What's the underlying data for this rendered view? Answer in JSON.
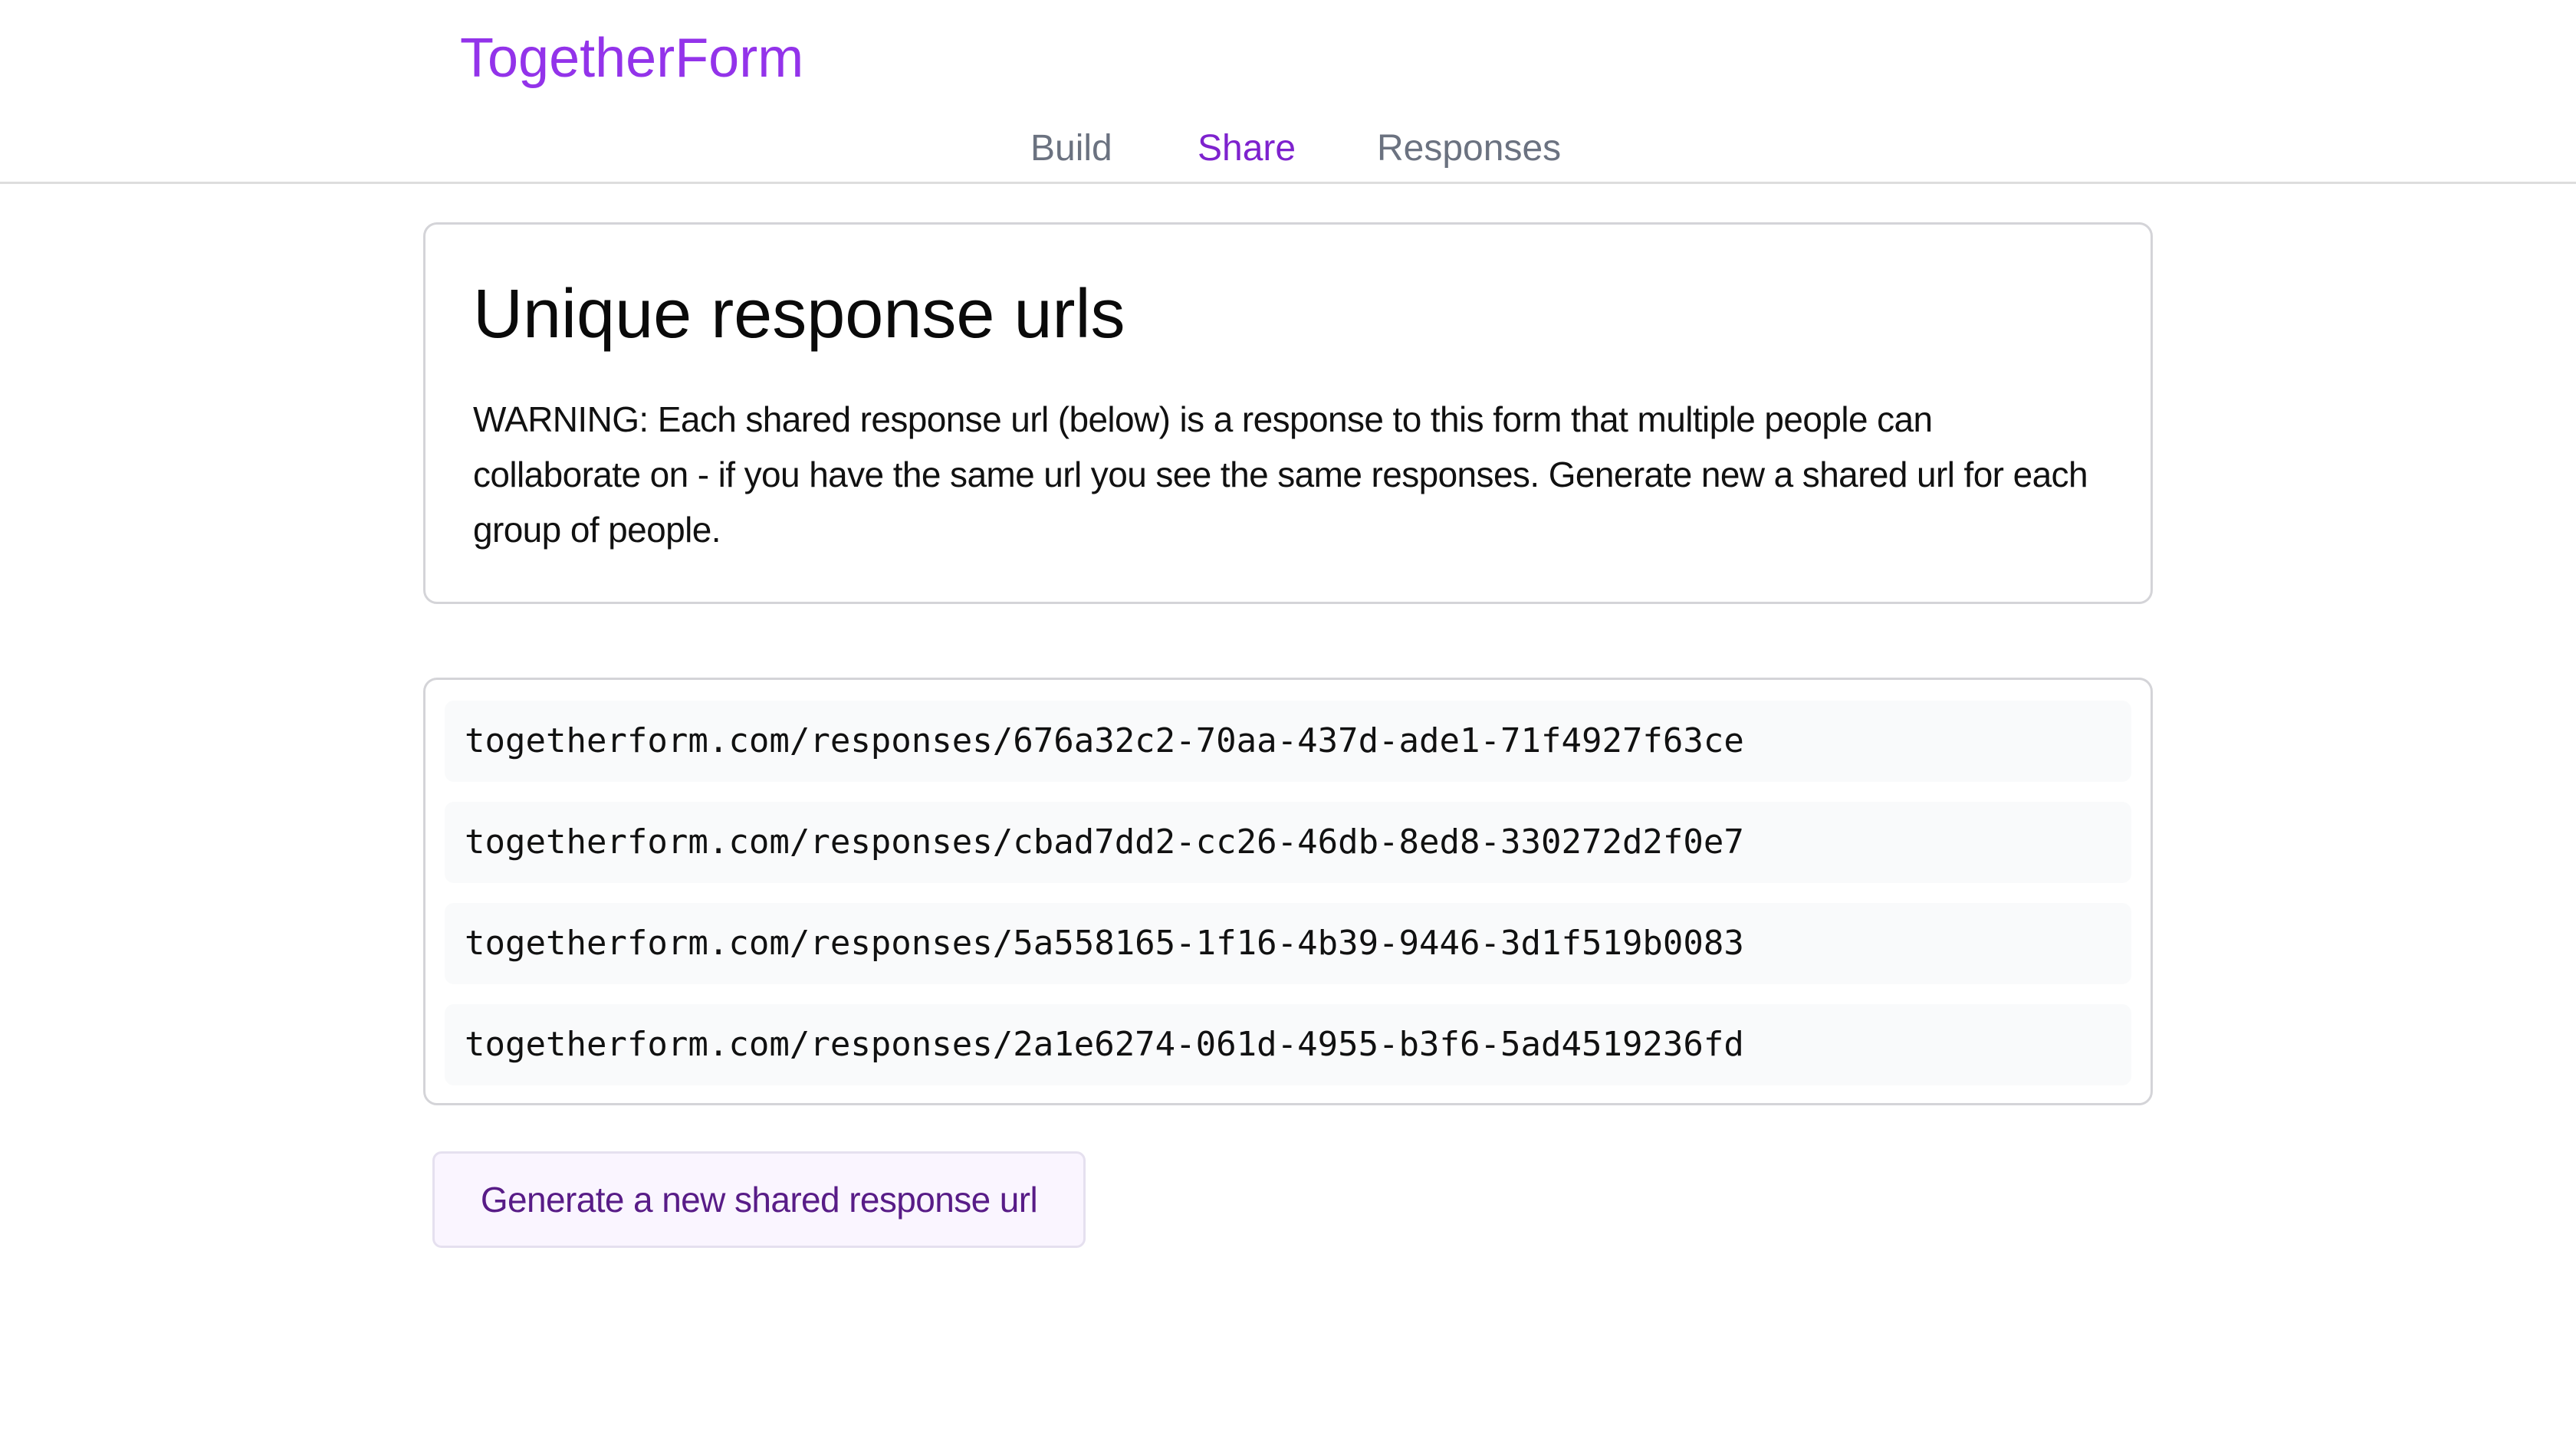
{
  "header": {
    "brand": "TogetherForm",
    "tabs": [
      {
        "label": "Build",
        "active": false
      },
      {
        "label": "Share",
        "active": true
      },
      {
        "label": "Responses",
        "active": false
      }
    ]
  },
  "warning_card": {
    "title": "Unique response urls",
    "text": "WARNING: Each shared response url (below) is a response to this form that multiple people can collaborate on - if you have the same url you see the same responses. Generate new a shared url for each group of people."
  },
  "urls": [
    "togetherform.com/responses/676a32c2-70aa-437d-ade1-71f4927f63ce",
    "togetherform.com/responses/cbad7dd2-cc26-46db-8ed8-330272d2f0e7",
    "togetherform.com/responses/5a558165-1f16-4b39-9446-3d1f519b0083",
    "togetherform.com/responses/2a1e6274-061d-4955-b3f6-5ad4519236fd"
  ],
  "generate_button": {
    "label": "Generate a new shared response url"
  },
  "colors": {
    "brand": "#9333ea",
    "active_tab": "#7e22ce",
    "inactive_tab": "#6b7280",
    "button_text": "#581c87",
    "button_bg": "#faf5ff"
  }
}
